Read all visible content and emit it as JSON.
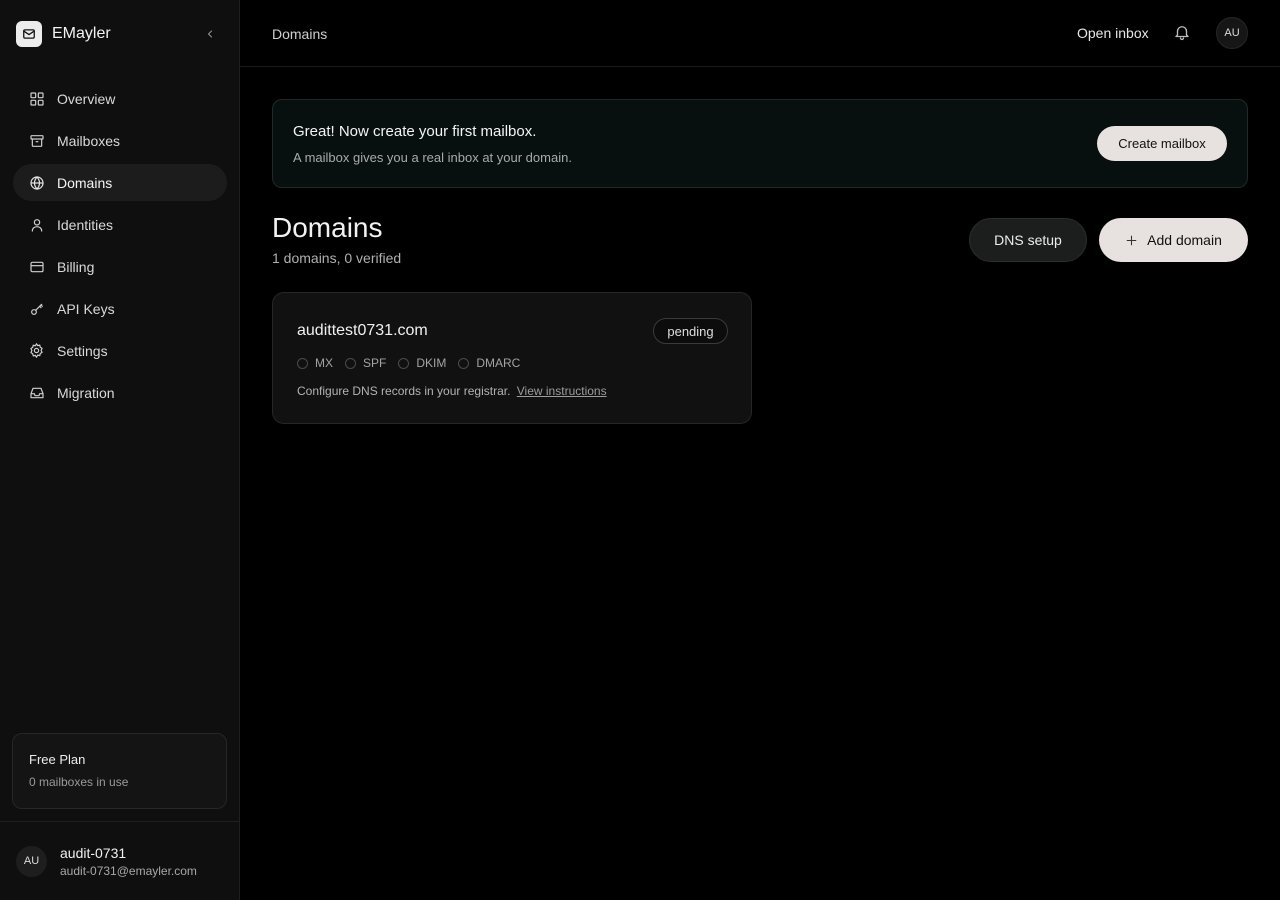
{
  "app": {
    "name": "EMayler"
  },
  "sidebar": {
    "items": [
      {
        "label": "Overview",
        "icon": "grid-icon"
      },
      {
        "label": "Mailboxes",
        "icon": "archive-icon"
      },
      {
        "label": "Domains",
        "icon": "globe-icon",
        "active": true
      },
      {
        "label": "Identities",
        "icon": "user-icon"
      },
      {
        "label": "Billing",
        "icon": "credit-card-icon"
      },
      {
        "label": "API Keys",
        "icon": "key-icon"
      },
      {
        "label": "Settings",
        "icon": "gear-icon"
      },
      {
        "label": "Migration",
        "icon": "inbox-icon"
      }
    ],
    "plan": {
      "title": "Free Plan",
      "subtitle": "0 mailboxes in use"
    },
    "user": {
      "initials": "AU",
      "name": "audit-0731",
      "email": "audit-0731@emayler.com"
    }
  },
  "topbar": {
    "breadcrumb": "Domains",
    "open_inbox": "Open inbox",
    "avatar_initials": "AU"
  },
  "banner": {
    "title": "Great! Now create your first mailbox.",
    "subtitle": "A mailbox gives you a real inbox at your domain.",
    "button": "Create mailbox"
  },
  "main": {
    "title": "Domains",
    "summary": "1 domains, 0 verified",
    "dns_setup": "DNS setup",
    "add_domain": "Add domain"
  },
  "domains": [
    {
      "name": "audittest0731.com",
      "status": "pending",
      "checks": [
        "MX",
        "SPF",
        "DKIM",
        "DMARC"
      ],
      "note": "Configure DNS records in your registrar.",
      "link": "View instructions"
    }
  ],
  "colors": {
    "background": "#000000",
    "sidebar": "#0f0f0f",
    "button_light": "#e7e2df",
    "banner_bg": "#07100f"
  }
}
